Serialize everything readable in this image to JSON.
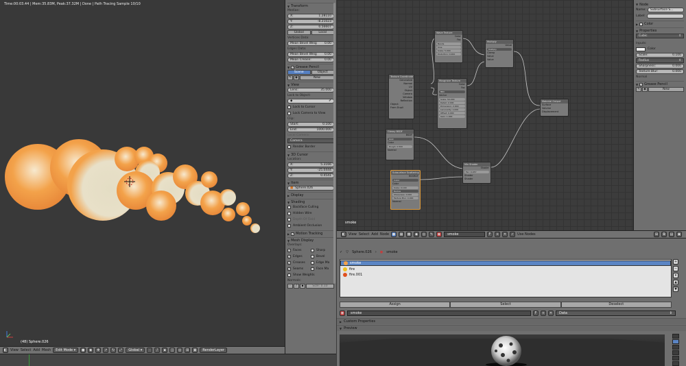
{
  "viewport": {
    "info": "Time:00:03.44 | Mem:35.83M, Peak:37.32M | Done | Path Tracing Sample 10/10",
    "object_label": "(48) Sphere.026"
  },
  "v3d_header": {
    "view": "View",
    "select": "Select",
    "add": "Add",
    "mesh": "Mesh",
    "mode": "Edit Mode",
    "orientation": "Global",
    "layer": "RenderLayer"
  },
  "npanel": {
    "transform": {
      "title": "Transform",
      "median": "Median:",
      "x_label": "X:",
      "x": "1.28110",
      "y_label": "Y:",
      "y": "-8.21023",
      "z_label": "Z:",
      "z": "0.56607",
      "global": "Global",
      "local": "Local",
      "vertex_data": "Vertices Data:",
      "mean_bevel_weight_v": "Mean Bevel Weig",
      "mean_bevel_weight_v_val": "0.00",
      "edges_data": "Edges Data:",
      "mean_bevel_weight_e": "Mean Bevel Weig",
      "mean_bevel_weight_e_val": "0.00",
      "mean_crease": "Mean Crease:",
      "mean_crease_val": "0.00"
    },
    "grease_pencil": {
      "title": "Grease Pencil",
      "scene": "Scene",
      "object": "Object",
      "new": "New"
    },
    "view": {
      "title": "View",
      "lens_label": "Lens:",
      "lens": "35.000",
      "lock_to_object": "Lock to Object:",
      "lock_to_cursor": "Lock to Cursor",
      "lock_camera": "Lock Camera to View",
      "clip": "Clip:",
      "start_label": "Start:",
      "start": "0.100",
      "end_label": "End:",
      "end": "1000.000",
      "local_camera": "Local Camera:",
      "camera": "Camera",
      "render_border": "Render Border"
    },
    "cursor": {
      "title": "3D Cursor",
      "location": "Location:",
      "x_label": "X:",
      "x": "5.3166",
      "y_label": "Y:",
      "y": "-25.0444",
      "z_label": "Z:",
      "z": "0.4541"
    },
    "item": {
      "title": "Item",
      "name": "Sphere.026"
    },
    "display": {
      "title": "Display"
    },
    "shading": {
      "title": "Shading",
      "backface": "Backface Culling",
      "hidden_wire": "Hidden Wire",
      "depth_of_field": "Depth Of Field",
      "ambient_occlusion": "Ambient Occlusion"
    },
    "motion_tracking": {
      "title": "Motion Tracking"
    },
    "mesh_display": {
      "title": "Mesh Display",
      "overlays": "Overlays:",
      "faces": "Faces",
      "sharp": "Sharp",
      "edges": "Edges",
      "bevel": "Bevel",
      "creases": "Creases",
      "edge_ma": "Edge Ma",
      "seams": "Seams",
      "face_ma": "Face Ma",
      "show_weights": "Show Weights",
      "normals": "Normals:",
      "size_label": "Size:",
      "size": "0.10"
    }
  },
  "node_editor": {
    "tree_name": "smoke",
    "nodes": {
      "wave_texture": {
        "title": "Wave Texture",
        "out1": "Color",
        "out2": "Fac",
        "f1": "Bands",
        "f2": "Sine",
        "scale": "Scale: 5.000",
        "distortion": "Distortion: 0.000"
      },
      "multiply": {
        "title": "Multiply",
        "out1": "Value",
        "f1": "Multiply",
        "clamp": "Clamp",
        "in1": "Value",
        "in2": "Value"
      },
      "texture_coordinate": {
        "title": "Texture Coordinate",
        "outs": [
          "Generated",
          "Normal",
          "UV",
          "Object",
          "Camera",
          "Window",
          "Reflection"
        ],
        "object": "Object:",
        "from_dupli": "From Dupli"
      },
      "musgrave": {
        "title": "Musgrave Texture",
        "out1": "Color",
        "out2": "Fac",
        "f1": "fBM",
        "f2": "Vector",
        "vals": [
          "Scale: 50.000",
          "Detail: 2.000",
          "Dimension: 2.000",
          "Lacunarity: 1.000",
          "Offset: 0.000",
          "Gain: 1.000"
        ]
      },
      "material_output": {
        "title": "Material Output",
        "ins": [
          "Surface",
          "Volume",
          "Displacement"
        ]
      },
      "glossy": {
        "title": "Glossy BSDF",
        "out": "BSDF",
        "dist": "GGX",
        "color": "Color",
        "roughness": "Rough: 0.500",
        "normal": "Normal"
      },
      "mix_shader": {
        "title": "Mix Shader",
        "out": "Shader",
        "fac": "Fac: 0.457",
        "in1": "Shader",
        "in2": "Shader"
      },
      "subsurface": {
        "title": "Subsurface Scattering",
        "out": "BSSRDF",
        "dist": "Cubic",
        "color": "Color",
        "scale": "Scale: 0.100",
        "radius": "Radius",
        "sharpness": "Sharpness: 0.000",
        "texture_blur": "Texture Blur: 0.000",
        "normal": "Normal"
      }
    }
  },
  "ne_header": {
    "view": "View",
    "select": "Select",
    "add": "Add",
    "node": "Node",
    "material": "smoke",
    "fake": "F",
    "use_nodes": "Use Nodes"
  },
  "ne_side": {
    "node": "Node",
    "name_label": "Name:",
    "name": "Subsurface S...",
    "label_label": "Label:",
    "color": "Color",
    "properties": "Properties",
    "falloff": "Cubic",
    "inputs": "Inputs:",
    "color_input": "Color",
    "scale_label": "Scale:",
    "scale": "0.100",
    "radius": "Radius",
    "sharpness_label": "Sharpness:",
    "sharpness": "0.000",
    "texture_blur_label": "Texture Blur:",
    "texture_blur": "0.000",
    "normal": "Normal",
    "grease_pencil": "Grease Pencil",
    "new": "New"
  },
  "props": {
    "object": "Sphere.026",
    "material": "smoke",
    "materials": [
      "smoke",
      "fire",
      "fire.001"
    ],
    "assign": "Assign",
    "select": "Select",
    "deselect": "Deselect",
    "slot_name": "smoke",
    "fake": "F",
    "link": "Data",
    "custom_properties": "Custom Properties",
    "preview": "Preview"
  },
  "colors": {
    "accent": "#5680c2",
    "sphere_orange": "#f3a24a",
    "sphere_cream": "#e8e0c8",
    "fire_red": "#e0501e",
    "mat_yellow": "#f0c020"
  }
}
